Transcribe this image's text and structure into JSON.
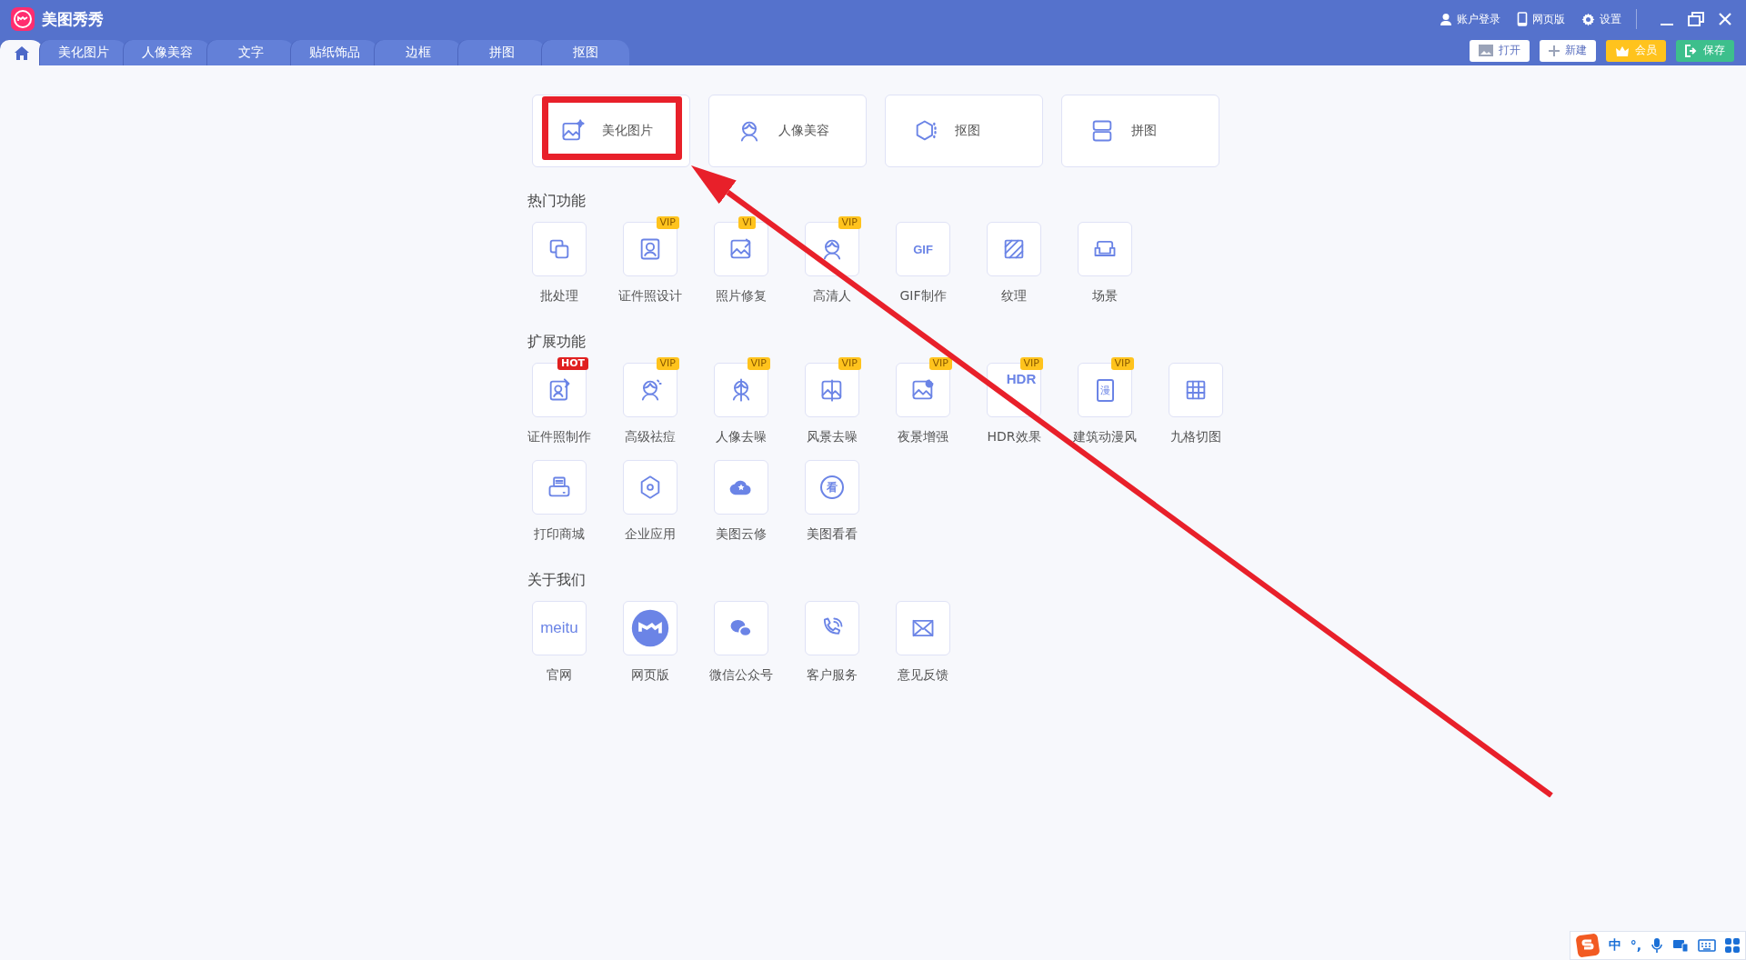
{
  "app": {
    "title": "美图秀秀"
  },
  "top_links": [
    {
      "label": "账户登录"
    },
    {
      "label": "网页版"
    },
    {
      "label": "设置"
    }
  ],
  "tabs": [
    {
      "kind": "home",
      "selected": true
    },
    {
      "kind": "text",
      "label": "美化图片",
      "selected": false
    },
    {
      "kind": "text",
      "label": "人像美容",
      "selected": false
    },
    {
      "kind": "text",
      "label": "文字",
      "selected": false
    },
    {
      "kind": "text",
      "label": "贴纸饰品",
      "selected": false
    },
    {
      "kind": "text",
      "label": "边框",
      "selected": false
    },
    {
      "kind": "text",
      "label": "拼图",
      "selected": false
    },
    {
      "kind": "text",
      "label": "抠图",
      "selected": false
    }
  ],
  "toolbar_buttons": [
    {
      "kind": "plain",
      "label": "打开"
    },
    {
      "kind": "plain",
      "label": "新建"
    },
    {
      "kind": "vip",
      "label": "会员"
    },
    {
      "kind": "save",
      "label": "保存"
    }
  ],
  "modes": [
    {
      "label": "美化图片"
    },
    {
      "label": "人像美容"
    },
    {
      "label": "抠图"
    },
    {
      "label": "拼图"
    }
  ],
  "sections": [
    {
      "title": "热门功能",
      "items": [
        {
          "label": "批处理"
        },
        {
          "label": "证件照设计",
          "badge": "VIP"
        },
        {
          "label": "照片修复",
          "badge": "VI"
        },
        {
          "label": "高清人",
          "badge": "VIP"
        },
        {
          "label": "GIF制作",
          "icon_text": "GIF"
        },
        {
          "label": "纹理"
        },
        {
          "label": "场景"
        }
      ]
    },
    {
      "title": "扩展功能",
      "items": [
        {
          "label": "证件照制作",
          "badge": "HOT"
        },
        {
          "label": "高级祛痘",
          "badge": "VIP"
        },
        {
          "label": "人像去噪",
          "badge": "VIP"
        },
        {
          "label": "风景去噪",
          "badge": "VIP"
        },
        {
          "label": "夜景增强",
          "badge": "VIP"
        },
        {
          "label": "HDR效果",
          "badge": "VIP",
          "icon_text": "HDR"
        },
        {
          "label": "建筑动漫风",
          "badge": "VIP",
          "icon_text": "漫"
        },
        {
          "label": "九格切图"
        },
        {
          "label": "打印商城"
        },
        {
          "label": "企业应用"
        },
        {
          "label": "美图云修"
        },
        {
          "label": "美图看看",
          "icon_text": "看"
        }
      ]
    },
    {
      "title": "关于我们",
      "items": [
        {
          "label": "官网",
          "icon_text": "meitu"
        },
        {
          "label": "网页版"
        },
        {
          "label": "微信公众号"
        },
        {
          "label": "客户服务"
        },
        {
          "label": "意见反馈"
        }
      ]
    }
  ],
  "ime": {
    "items": [
      "中",
      "°,"
    ]
  }
}
